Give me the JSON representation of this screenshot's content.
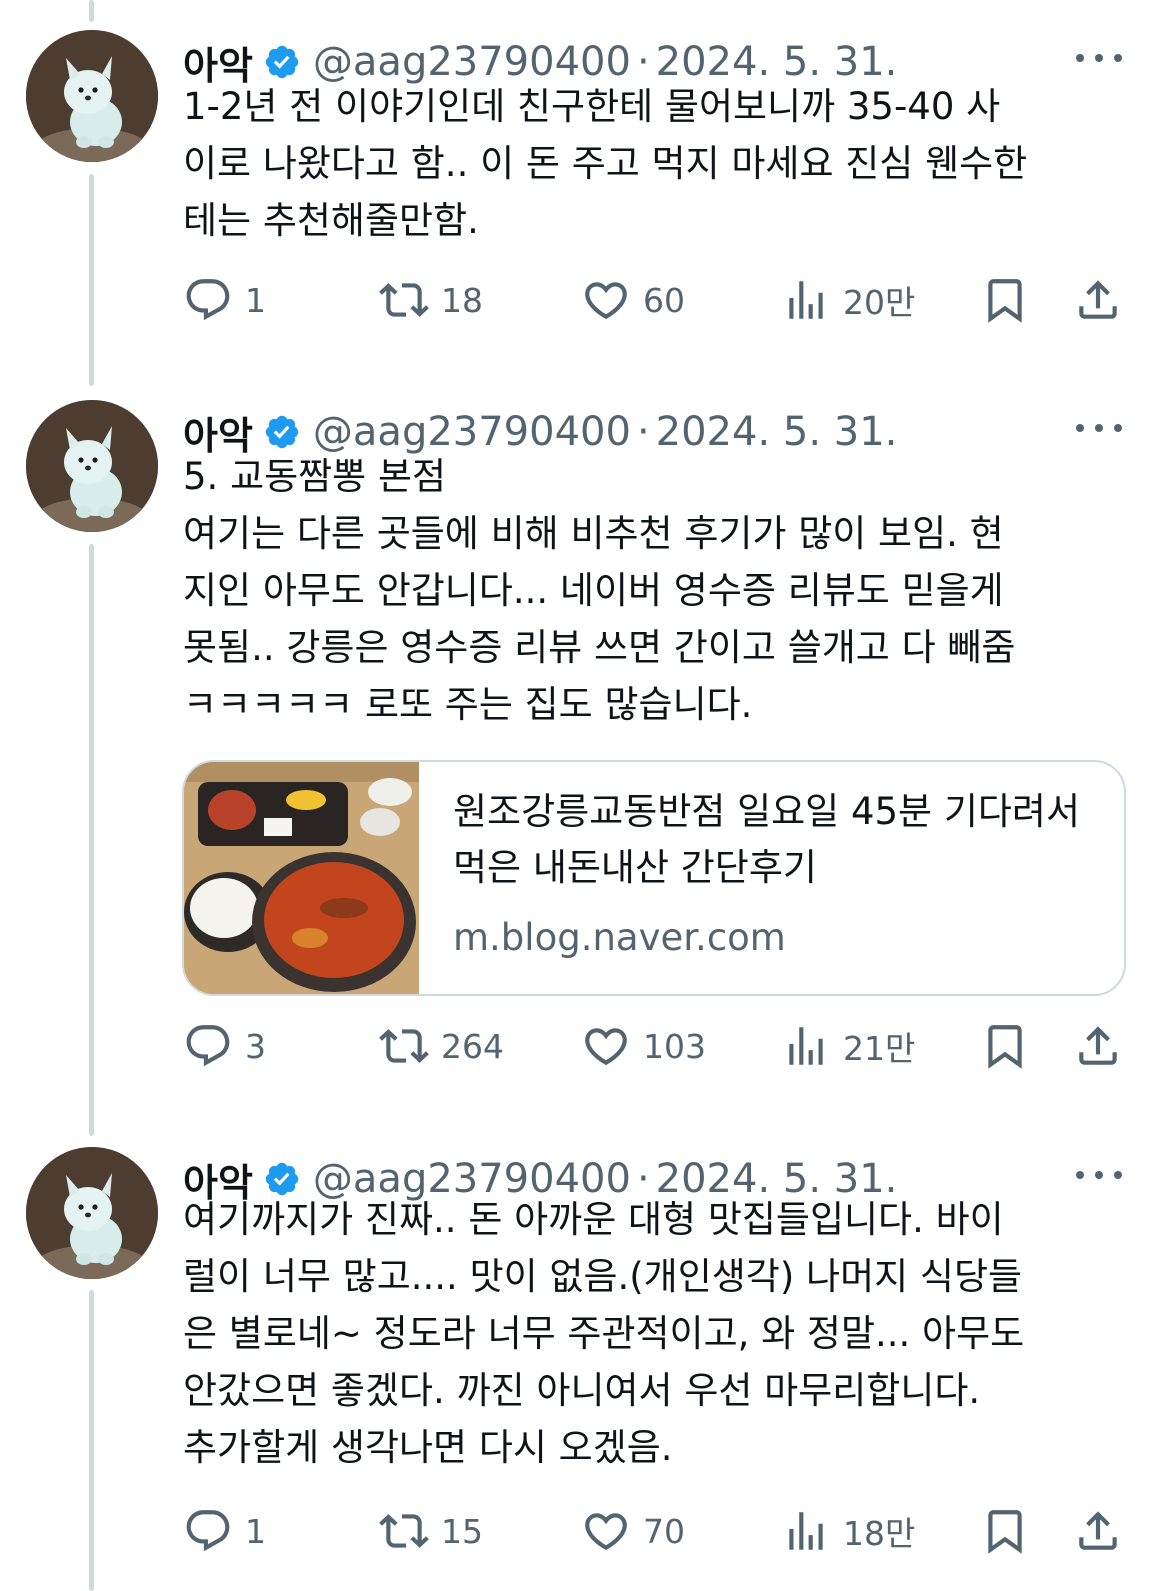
{
  "tweets": [
    {
      "name": "아악",
      "handle": "@aag23790400",
      "separator": "·",
      "date": "2024. 5. 31.",
      "text": "1-2년 전 이야기인데 친구한테 물어보니까 35-40 사\n이로 나왔다고 함.. 이 돈 주고 먹지 마세요 진심 웬수한\n테는 추천해줄만함.",
      "counts": {
        "reply": "1",
        "retweet": "18",
        "like": "60",
        "views": "20만"
      }
    },
    {
      "name": "아악",
      "handle": "@aag23790400",
      "separator": "·",
      "date": "2024. 5. 31.",
      "text": "5. 교동짬뽕 본점\n여기는 다른 곳들에 비해 비추천 후기가 많이 보임. 현\n지인 아무도 안갑니다... 네이버 영수증 리뷰도 믿을게\n못됨.. 강릉은 영수증 리뷰 쓰면 간이고 쓸개고 다 빼줌\nㅋㅋㅋㅋㅋ 로또 주는 집도 많습니다.",
      "card": {
        "title": "원조강릉교동반점 일요일 45분 기다려서 먹은 내돈내산 간단후기",
        "domain": "m.blog.naver.com"
      },
      "counts": {
        "reply": "3",
        "retweet": "264",
        "like": "103",
        "views": "21만"
      }
    },
    {
      "name": "아악",
      "handle": "@aag23790400",
      "separator": "·",
      "date": "2024. 5. 31.",
      "text": "여기까지가 진짜.. 돈 아까운 대형 맛집들입니다. 바이\n럴이 너무 많고.... 맛이 없음.(개인생각) 나머지 식당들\n은 별로네~ 정도라 너무 주관적이고, 와 정말... 아무도\n안갔으면 좋겠다. 까진 아니여서 우선 마무리합니다.\n추가할게 생각나면 다시 오겠음.",
      "counts": {
        "reply": "1",
        "retweet": "15",
        "like": "70",
        "views": "18만"
      }
    }
  ],
  "icons": {
    "verified": "verified-badge-icon",
    "more": "more-options-icon",
    "reply": "reply-icon",
    "retweet": "retweet-icon",
    "like": "like-icon",
    "views": "views-icon",
    "bookmark": "bookmark-icon",
    "share": "share-icon"
  },
  "colors": {
    "verified_blue": "#1d9bf0",
    "text_primary": "#0f1419",
    "text_secondary": "#536471",
    "thread_line": "#cfd9de"
  }
}
